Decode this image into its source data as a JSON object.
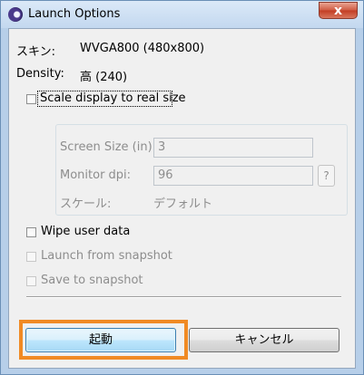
{
  "window": {
    "title": "Launch Options",
    "close_glyph": "x",
    "app_icon": "eclipse-icon"
  },
  "info": {
    "skin_label": "スキン:",
    "skin_value": "WVGA800 (480x800)",
    "density_label": "Density:",
    "density_value": "高 (240)"
  },
  "options": {
    "scale_display": {
      "label": "Scale display to real size",
      "checked": false
    },
    "wipe_user_data": {
      "label": "Wipe user data",
      "checked": false
    },
    "launch_from_snapshot": {
      "label": "Launch from snapshot",
      "checked": false,
      "enabled": false
    },
    "save_to_snapshot": {
      "label": "Save to snapshot",
      "checked": false,
      "enabled": false
    }
  },
  "scale_group": {
    "screen_size_label": "Screen Size (in):",
    "screen_size_value": "3",
    "monitor_dpi_label": "Monitor dpi:",
    "monitor_dpi_value": "96",
    "help_label": "?",
    "scale_label": "スケール:",
    "scale_value": "デフォルト"
  },
  "buttons": {
    "launch": "起動",
    "cancel": "キャンセル"
  },
  "colors": {
    "highlight": "#f08a24",
    "title_bar": "#c8dcf2",
    "close_button": "#c23c23"
  }
}
